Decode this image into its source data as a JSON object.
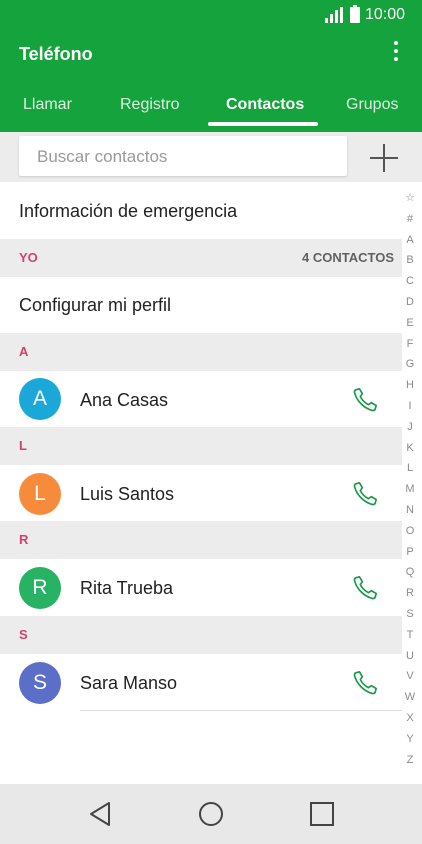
{
  "status": {
    "time": "10:00",
    "signal_icon": "signal-icon",
    "battery_icon": "battery-icon"
  },
  "app": {
    "title": "Teléfono",
    "menu_icon": "more-vert-icon",
    "accent": "#14a33c"
  },
  "tabs": [
    {
      "label": "Llamar"
    },
    {
      "label": "Registro"
    },
    {
      "label": "Contactos",
      "active": true
    },
    {
      "label": "Grupos"
    }
  ],
  "search": {
    "placeholder": "Buscar contactos",
    "add_icon": "plus-icon"
  },
  "emergency": {
    "label": "Información de emergencia"
  },
  "me_section": {
    "letter": "YO",
    "count": "4 CONTACTOS"
  },
  "profile": {
    "label": "Configurar mi perfil"
  },
  "sections": [
    {
      "letter": "A",
      "contact": {
        "initial": "A",
        "name": "Ana Casas",
        "color": "#1ba8d9"
      }
    },
    {
      "letter": "L",
      "contact": {
        "initial": "L",
        "name": "Luis Santos",
        "color": "#f68b3c"
      }
    },
    {
      "letter": "R",
      "contact": {
        "initial": "R",
        "name": "Rita Trueba",
        "color": "#27b363"
      }
    },
    {
      "letter": "S",
      "contact": {
        "initial": "S",
        "name": "Sara Manso",
        "color": "#5c6fc8"
      }
    }
  ],
  "alphabet": [
    "☆",
    "#",
    "A",
    "B",
    "C",
    "D",
    "E",
    "F",
    "G",
    "H",
    "I",
    "J",
    "K",
    "L",
    "M",
    "N",
    "O",
    "P",
    "Q",
    "R",
    "S",
    "T",
    "U",
    "V",
    "W",
    "X",
    "Y",
    "Z"
  ],
  "colors": {
    "section_letter": "#d6406b",
    "phone_icon": "#1a9a4a"
  }
}
